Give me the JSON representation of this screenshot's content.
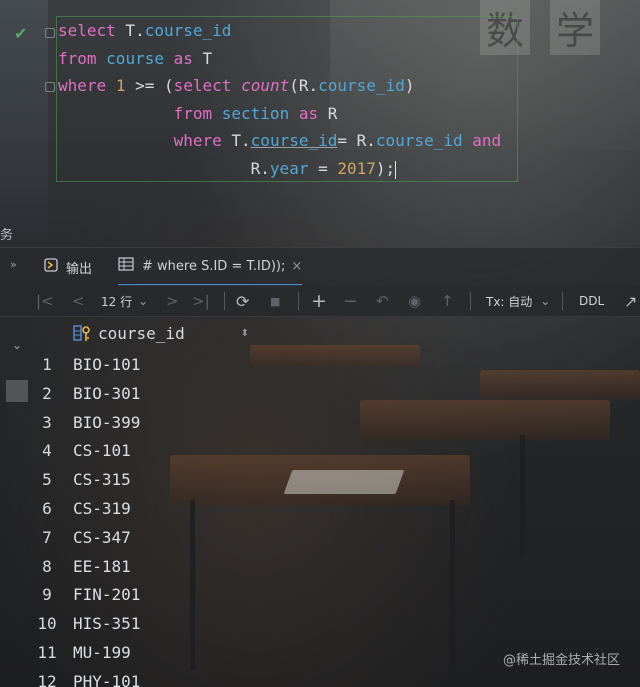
{
  "editor": {
    "lines": [
      [
        {
          "t": "select",
          "c": "kw"
        },
        {
          "t": " T.",
          "c": "plain"
        },
        {
          "t": "course_id",
          "c": "col"
        }
      ],
      [
        {
          "t": "from",
          "c": "kw"
        },
        {
          "t": " ",
          "c": "plain"
        },
        {
          "t": "course",
          "c": "col"
        },
        {
          "t": " ",
          "c": "plain"
        },
        {
          "t": "as",
          "c": "kw"
        },
        {
          "t": " T",
          "c": "plain"
        }
      ],
      [
        {
          "t": "where",
          "c": "kw"
        },
        {
          "t": " ",
          "c": "plain"
        },
        {
          "t": "1",
          "c": "num"
        },
        {
          "t": " >= (",
          "c": "plain"
        },
        {
          "t": "select",
          "c": "kw"
        },
        {
          "t": " ",
          "c": "plain"
        },
        {
          "t": "count",
          "c": "fn"
        },
        {
          "t": "(R.",
          "c": "plain"
        },
        {
          "t": "course_id",
          "c": "col"
        },
        {
          "t": ")",
          "c": "plain"
        }
      ],
      [
        {
          "t": "            ",
          "c": "plain"
        },
        {
          "t": "from",
          "c": "kw"
        },
        {
          "t": " ",
          "c": "plain"
        },
        {
          "t": "section",
          "c": "col"
        },
        {
          "t": " ",
          "c": "plain"
        },
        {
          "t": "as",
          "c": "kw"
        },
        {
          "t": " R",
          "c": "plain"
        }
      ],
      [
        {
          "t": "            ",
          "c": "plain"
        },
        {
          "t": "where",
          "c": "kw"
        },
        {
          "t": " T.",
          "c": "plain"
        },
        {
          "t": "course_id",
          "c": "col underline"
        },
        {
          "t": "= R.",
          "c": "plain"
        },
        {
          "t": "course_id",
          "c": "col"
        },
        {
          "t": " ",
          "c": "plain"
        },
        {
          "t": "and",
          "c": "kw"
        }
      ],
      [
        {
          "t": "                    R.",
          "c": "plain"
        },
        {
          "t": "year",
          "c": "col"
        },
        {
          "t": " = ",
          "c": "plain"
        },
        {
          "t": "2017",
          "c": "num"
        },
        {
          "t": ");",
          "c": "plain"
        }
      ]
    ]
  },
  "scene": {
    "chars": [
      "数",
      "学"
    ]
  },
  "side_label": "务",
  "tabs": {
    "expand": "»",
    "output_label": "输出",
    "result_label": "# where S.ID = T.ID));",
    "close": "×"
  },
  "toolbar": {
    "first": "|<",
    "prev": "<",
    "rows": "12 行",
    "rows_caret": "⌄",
    "next": ">",
    "last": ">|",
    "refresh": "⟳",
    "stop": "■",
    "add": "+",
    "remove": "−",
    "revert": "↶",
    "view": "◉",
    "submit": "↑",
    "tx": "Tx: 自动",
    "tx_caret": "⌄",
    "ddl": "DDL",
    "more": "↗"
  },
  "grid": {
    "column": "course_id",
    "sort": "⬍",
    "expand": "⌄",
    "rows": [
      {
        "n": "1",
        "v": "BIO-101"
      },
      {
        "n": "2",
        "v": "BIO-301"
      },
      {
        "n": "3",
        "v": "BIO-399"
      },
      {
        "n": "4",
        "v": "CS-101"
      },
      {
        "n": "5",
        "v": "CS-315"
      },
      {
        "n": "6",
        "v": "CS-319"
      },
      {
        "n": "7",
        "v": "CS-347"
      },
      {
        "n": "8",
        "v": "EE-181"
      },
      {
        "n": "9",
        "v": "FIN-201"
      },
      {
        "n": "10",
        "v": "HIS-351"
      },
      {
        "n": "11",
        "v": "MU-199"
      },
      {
        "n": "12",
        "v": "PHY-101"
      }
    ]
  },
  "watermark": "@稀土掘金技术社区",
  "colors": {
    "keyword": "#e170c4",
    "column": "#52a7d6",
    "number": "#d2a466",
    "check": "#59a869",
    "active_tab": "#4a88c7"
  }
}
